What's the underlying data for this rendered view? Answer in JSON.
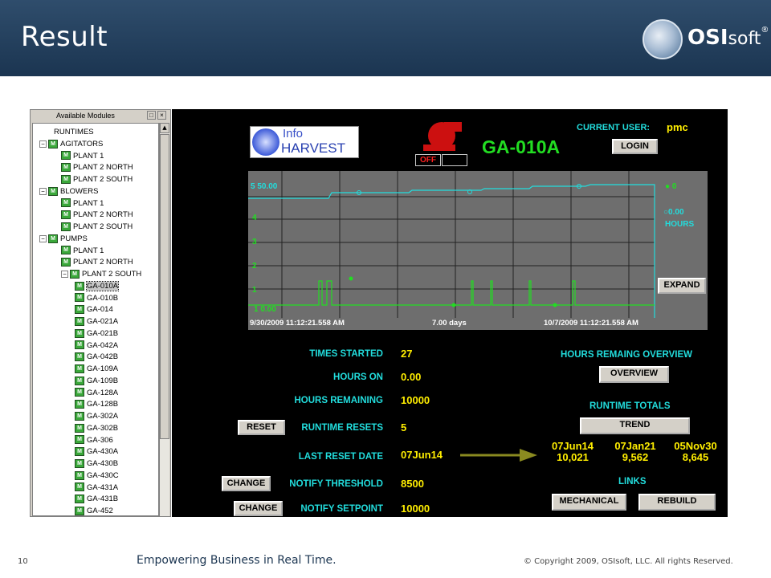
{
  "slide": {
    "title": "Result",
    "brand": {
      "bold": "OSI",
      "light": "soft",
      "mark": "®"
    },
    "page_number": "10",
    "tagline": "Empowering Business in Real Time.",
    "copyright": "© Copyright 2009, OSIsoft, LLC. All rights Reserved."
  },
  "tree": {
    "title": "Available Modules",
    "nodes": [
      {
        "label": "RUNTIMES",
        "level": 0,
        "icon": false,
        "expander": ""
      },
      {
        "label": "AGITATORS",
        "level": 1,
        "icon": true,
        "expander": "−"
      },
      {
        "label": "PLANT 1",
        "level": 2,
        "icon": true,
        "expander": ""
      },
      {
        "label": "PLANT 2 NORTH",
        "level": 2,
        "icon": true,
        "expander": ""
      },
      {
        "label": "PLANT 2 SOUTH",
        "level": 2,
        "icon": true,
        "expander": ""
      },
      {
        "label": "BLOWERS",
        "level": 1,
        "icon": true,
        "expander": "−"
      },
      {
        "label": "PLANT 1",
        "level": 2,
        "icon": true,
        "expander": ""
      },
      {
        "label": "PLANT 2 NORTH",
        "level": 2,
        "icon": true,
        "expander": ""
      },
      {
        "label": "PLANT 2 SOUTH",
        "level": 2,
        "icon": true,
        "expander": ""
      },
      {
        "label": "PUMPS",
        "level": 1,
        "icon": true,
        "expander": "−"
      },
      {
        "label": "PLANT 1",
        "level": 2,
        "icon": true,
        "expander": ""
      },
      {
        "label": "PLANT 2 NORTH",
        "level": 2,
        "icon": true,
        "expander": ""
      },
      {
        "label": "PLANT 2 SOUTH",
        "level": 2,
        "icon": true,
        "expander": "−"
      },
      {
        "label": "GA-010A",
        "level": 3,
        "icon": true,
        "expander": "",
        "selected": true
      },
      {
        "label": "GA-010B",
        "level": 3,
        "icon": true,
        "expander": ""
      },
      {
        "label": "GA-014",
        "level": 3,
        "icon": true,
        "expander": ""
      },
      {
        "label": "GA-021A",
        "level": 3,
        "icon": true,
        "expander": ""
      },
      {
        "label": "GA-021B",
        "level": 3,
        "icon": true,
        "expander": ""
      },
      {
        "label": "GA-042A",
        "level": 3,
        "icon": true,
        "expander": ""
      },
      {
        "label": "GA-042B",
        "level": 3,
        "icon": true,
        "expander": ""
      },
      {
        "label": "GA-109A",
        "level": 3,
        "icon": true,
        "expander": ""
      },
      {
        "label": "GA-109B",
        "level": 3,
        "icon": true,
        "expander": ""
      },
      {
        "label": "GA-128A",
        "level": 3,
        "icon": true,
        "expander": ""
      },
      {
        "label": "GA-128B",
        "level": 3,
        "icon": true,
        "expander": ""
      },
      {
        "label": "GA-302A",
        "level": 3,
        "icon": true,
        "expander": ""
      },
      {
        "label": "GA-302B",
        "level": 3,
        "icon": true,
        "expander": ""
      },
      {
        "label": "GA-306",
        "level": 3,
        "icon": true,
        "expander": ""
      },
      {
        "label": "GA-430A",
        "level": 3,
        "icon": true,
        "expander": ""
      },
      {
        "label": "GA-430B",
        "level": 3,
        "icon": true,
        "expander": ""
      },
      {
        "label": "GA-430C",
        "level": 3,
        "icon": true,
        "expander": ""
      },
      {
        "label": "GA-431A",
        "level": 3,
        "icon": true,
        "expander": ""
      },
      {
        "label": "GA-431B",
        "level": 3,
        "icon": true,
        "expander": ""
      },
      {
        "label": "GA-452",
        "level": 3,
        "icon": true,
        "expander": ""
      }
    ]
  },
  "display": {
    "logo": {
      "line1": "Info",
      "line2": "HARVEST"
    },
    "status": "OFF",
    "tag": "GA-010A",
    "current_user_label": "CURRENT USER:",
    "current_user": "pmc",
    "login_button": "LOGIN",
    "expand_button": "EXPAND",
    "trend": {
      "top_left_label": "5   50.00",
      "bottom_left_label": "1  0.00",
      "y_ticks": [
        "4",
        "3",
        "2",
        "1"
      ],
      "start_time": "9/30/2009 11:12:21.558 AM",
      "span": "7.00 days",
      "end_time": "10/7/2009 11:12:21.558 AM",
      "right_top_value": "0",
      "right_hours_value": "0.00",
      "right_hours_label": "HOURS"
    },
    "metrics": [
      {
        "label": "TIMES STARTED",
        "value": "27"
      },
      {
        "label": "HOURS ON",
        "value": "0.00"
      },
      {
        "label": "HOURS REMAINING",
        "value": "10000"
      },
      {
        "label": "RUNTIME RESETS",
        "value": "5",
        "button": "RESET"
      },
      {
        "label": "LAST RESET DATE",
        "value": "07Jun14"
      },
      {
        "label": "NOTIFY THRESHOLD",
        "value": "8500",
        "button": "CHANGE"
      },
      {
        "label": "NOTIFY SETPOINT",
        "value": "10000",
        "button": "CHANGE"
      }
    ],
    "hours_overview_label": "HOURS REMAING OVERVIEW",
    "overview_button": "OVERVIEW",
    "runtime_totals_label": "RUNTIME TOTALS",
    "trend_button": "TREND",
    "runtime_totals": [
      {
        "date": "07Jun14",
        "value": "10,021"
      },
      {
        "date": "07Jan21",
        "value": "9,562"
      },
      {
        "date": "05Nov30",
        "value": "8,645"
      }
    ],
    "links_label": "LINKS",
    "mechanical_button": "MECHANICAL",
    "rebuild_button": "REBUILD"
  },
  "colors": {
    "header": "#1b3551",
    "panel": "#000000",
    "cyan": "#22dddd",
    "green": "#22dd22",
    "yellow": "#ffee00",
    "chart_bg": "#6e6e6e"
  }
}
